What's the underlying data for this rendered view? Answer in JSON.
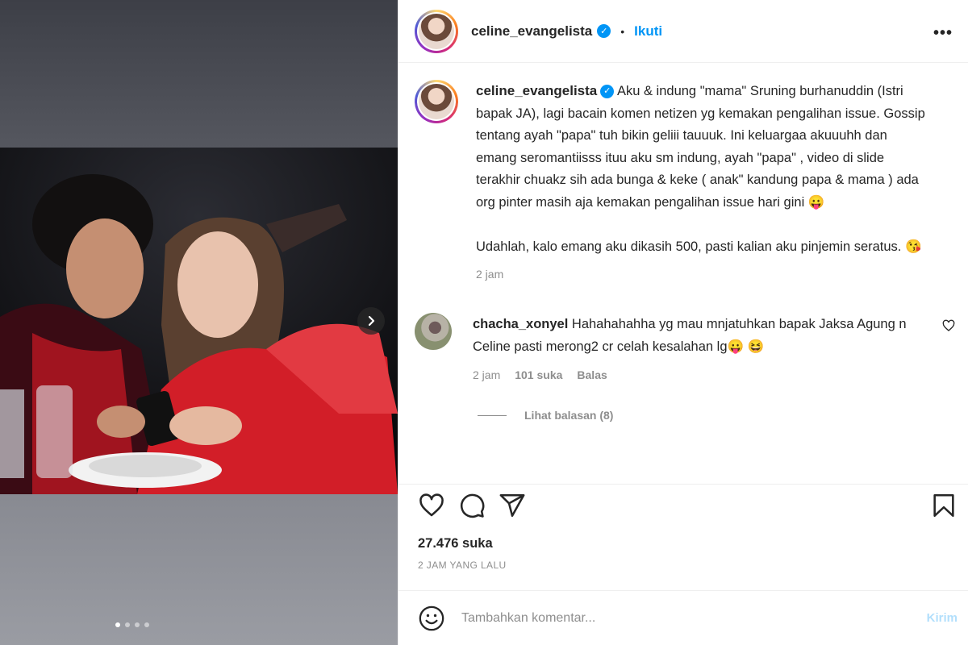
{
  "post": {
    "username": "celine_evangelista",
    "follow_label": "Ikuti",
    "separator": "•"
  },
  "caption": {
    "username": "celine_evangelista",
    "text": "Aku & indung \"mama\" Sruning burhanuddin (Istri bapak JA), lagi bacain komen netizen yg kemakan pengalihan issue. Gossip tentang ayah \"papa\" tuh bikin geliii tauuuk. Ini keluargaa akuuuhh dan emang seromantiisss ituu aku sm indung, ayah \"papa\" , video di slide terakhir chuakz sih ada bunga & keke ( anak\" kandung papa & mama ) ada org pinter masih aja kemakan pengalihan issue hari gini 😛\n\nUdahlah, kalo emang aku dikasih 500, pasti kalian aku pinjemin seratus. 😘",
    "time": "2 jam"
  },
  "comment": {
    "username": "chacha_xonyel",
    "text": "Hahahahahha yg mau mnjatuhkan bapak Jaksa Agung n Celine pasti merong2 cr celah kesalahan lg😛 😆",
    "time": "2 jam",
    "likes": "101 suka",
    "reply_label": "Balas",
    "view_replies": "Lihat balasan (8)"
  },
  "stats": {
    "likes": "27.476 suka",
    "ago": "2 JAM YANG LALU"
  },
  "add_comment": {
    "placeholder": "Tambahkan komentar...",
    "post_label": "Kirim"
  },
  "carousel": {
    "slide_count": 4,
    "active_index": 0
  },
  "colors": {
    "link_blue": "#0095f6",
    "muted": "#8e8e8e",
    "post_disabled": "#b2dffc"
  },
  "icons": [
    "more-icon",
    "verified-icon",
    "chevron-right-icon",
    "heart-icon",
    "comment-icon",
    "share-icon",
    "bookmark-icon",
    "emoji-icon"
  ]
}
